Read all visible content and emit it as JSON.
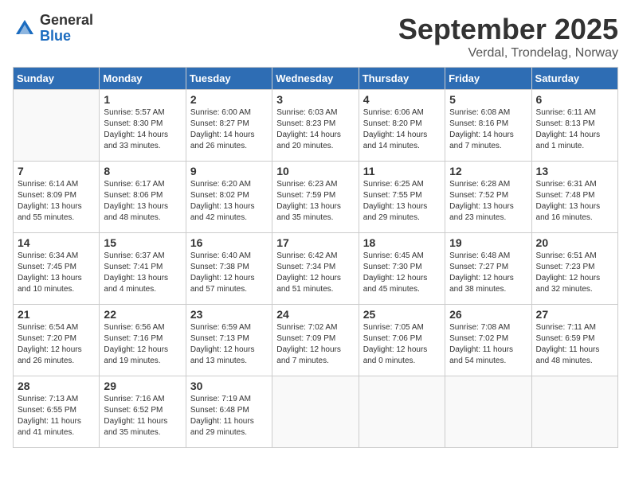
{
  "logo": {
    "general": "General",
    "blue": "Blue"
  },
  "title": {
    "month": "September 2025",
    "location": "Verdal, Trondelag, Norway"
  },
  "weekdays": [
    "Sunday",
    "Monday",
    "Tuesday",
    "Wednesday",
    "Thursday",
    "Friday",
    "Saturday"
  ],
  "weeks": [
    [
      {
        "day": "",
        "info": ""
      },
      {
        "day": "1",
        "info": "Sunrise: 5:57 AM\nSunset: 8:30 PM\nDaylight: 14 hours\nand 33 minutes."
      },
      {
        "day": "2",
        "info": "Sunrise: 6:00 AM\nSunset: 8:27 PM\nDaylight: 14 hours\nand 26 minutes."
      },
      {
        "day": "3",
        "info": "Sunrise: 6:03 AM\nSunset: 8:23 PM\nDaylight: 14 hours\nand 20 minutes."
      },
      {
        "day": "4",
        "info": "Sunrise: 6:06 AM\nSunset: 8:20 PM\nDaylight: 14 hours\nand 14 minutes."
      },
      {
        "day": "5",
        "info": "Sunrise: 6:08 AM\nSunset: 8:16 PM\nDaylight: 14 hours\nand 7 minutes."
      },
      {
        "day": "6",
        "info": "Sunrise: 6:11 AM\nSunset: 8:13 PM\nDaylight: 14 hours\nand 1 minute."
      }
    ],
    [
      {
        "day": "7",
        "info": "Sunrise: 6:14 AM\nSunset: 8:09 PM\nDaylight: 13 hours\nand 55 minutes."
      },
      {
        "day": "8",
        "info": "Sunrise: 6:17 AM\nSunset: 8:06 PM\nDaylight: 13 hours\nand 48 minutes."
      },
      {
        "day": "9",
        "info": "Sunrise: 6:20 AM\nSunset: 8:02 PM\nDaylight: 13 hours\nand 42 minutes."
      },
      {
        "day": "10",
        "info": "Sunrise: 6:23 AM\nSunset: 7:59 PM\nDaylight: 13 hours\nand 35 minutes."
      },
      {
        "day": "11",
        "info": "Sunrise: 6:25 AM\nSunset: 7:55 PM\nDaylight: 13 hours\nand 29 minutes."
      },
      {
        "day": "12",
        "info": "Sunrise: 6:28 AM\nSunset: 7:52 PM\nDaylight: 13 hours\nand 23 minutes."
      },
      {
        "day": "13",
        "info": "Sunrise: 6:31 AM\nSunset: 7:48 PM\nDaylight: 13 hours\nand 16 minutes."
      }
    ],
    [
      {
        "day": "14",
        "info": "Sunrise: 6:34 AM\nSunset: 7:45 PM\nDaylight: 13 hours\nand 10 minutes."
      },
      {
        "day": "15",
        "info": "Sunrise: 6:37 AM\nSunset: 7:41 PM\nDaylight: 13 hours\nand 4 minutes."
      },
      {
        "day": "16",
        "info": "Sunrise: 6:40 AM\nSunset: 7:38 PM\nDaylight: 12 hours\nand 57 minutes."
      },
      {
        "day": "17",
        "info": "Sunrise: 6:42 AM\nSunset: 7:34 PM\nDaylight: 12 hours\nand 51 minutes."
      },
      {
        "day": "18",
        "info": "Sunrise: 6:45 AM\nSunset: 7:30 PM\nDaylight: 12 hours\nand 45 minutes."
      },
      {
        "day": "19",
        "info": "Sunrise: 6:48 AM\nSunset: 7:27 PM\nDaylight: 12 hours\nand 38 minutes."
      },
      {
        "day": "20",
        "info": "Sunrise: 6:51 AM\nSunset: 7:23 PM\nDaylight: 12 hours\nand 32 minutes."
      }
    ],
    [
      {
        "day": "21",
        "info": "Sunrise: 6:54 AM\nSunset: 7:20 PM\nDaylight: 12 hours\nand 26 minutes."
      },
      {
        "day": "22",
        "info": "Sunrise: 6:56 AM\nSunset: 7:16 PM\nDaylight: 12 hours\nand 19 minutes."
      },
      {
        "day": "23",
        "info": "Sunrise: 6:59 AM\nSunset: 7:13 PM\nDaylight: 12 hours\nand 13 minutes."
      },
      {
        "day": "24",
        "info": "Sunrise: 7:02 AM\nSunset: 7:09 PM\nDaylight: 12 hours\nand 7 minutes."
      },
      {
        "day": "25",
        "info": "Sunrise: 7:05 AM\nSunset: 7:06 PM\nDaylight: 12 hours\nand 0 minutes."
      },
      {
        "day": "26",
        "info": "Sunrise: 7:08 AM\nSunset: 7:02 PM\nDaylight: 11 hours\nand 54 minutes."
      },
      {
        "day": "27",
        "info": "Sunrise: 7:11 AM\nSunset: 6:59 PM\nDaylight: 11 hours\nand 48 minutes."
      }
    ],
    [
      {
        "day": "28",
        "info": "Sunrise: 7:13 AM\nSunset: 6:55 PM\nDaylight: 11 hours\nand 41 minutes."
      },
      {
        "day": "29",
        "info": "Sunrise: 7:16 AM\nSunset: 6:52 PM\nDaylight: 11 hours\nand 35 minutes."
      },
      {
        "day": "30",
        "info": "Sunrise: 7:19 AM\nSunset: 6:48 PM\nDaylight: 11 hours\nand 29 minutes."
      },
      {
        "day": "",
        "info": ""
      },
      {
        "day": "",
        "info": ""
      },
      {
        "day": "",
        "info": ""
      },
      {
        "day": "",
        "info": ""
      }
    ]
  ]
}
